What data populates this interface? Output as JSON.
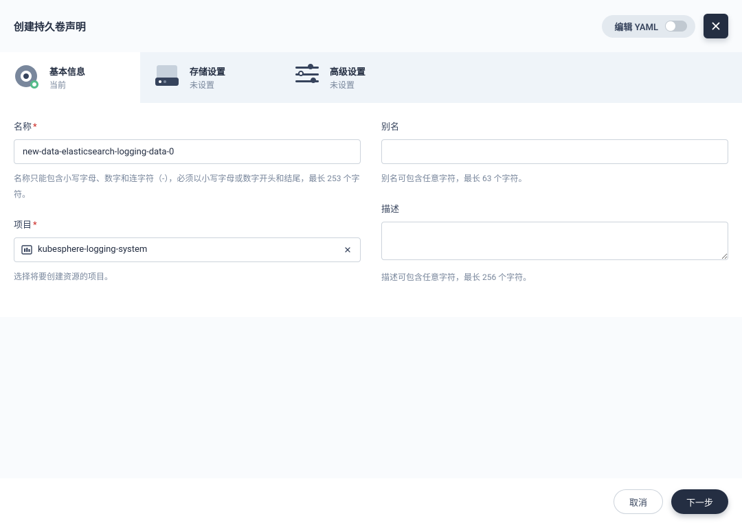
{
  "header": {
    "title": "创建持久卷声明",
    "yaml_label": "编辑 YAML"
  },
  "tabs": [
    {
      "title": "基本信息",
      "sub": "当前",
      "active": true
    },
    {
      "title": "存储设置",
      "sub": "未设置",
      "active": false
    },
    {
      "title": "高级设置",
      "sub": "未设置",
      "active": false
    }
  ],
  "form": {
    "name": {
      "label": "名称",
      "value": "new-data-elasticsearch-logging-data-0",
      "hint": "名称只能包含小写字母、数字和连字符（-），必须以小写字母或数字开头和结尾，最长 253 个字符。"
    },
    "alias": {
      "label": "别名",
      "value": "",
      "hint": "别名可包含任意字符，最长 63 个字符。"
    },
    "project": {
      "label": "项目",
      "value": "kubesphere-logging-system",
      "hint": "选择将要创建资源的项目。"
    },
    "description": {
      "label": "描述",
      "value": "",
      "hint": "描述可包含任意字符，最长 256 个字符。"
    }
  },
  "footer": {
    "cancel": "取消",
    "next": "下一步"
  }
}
